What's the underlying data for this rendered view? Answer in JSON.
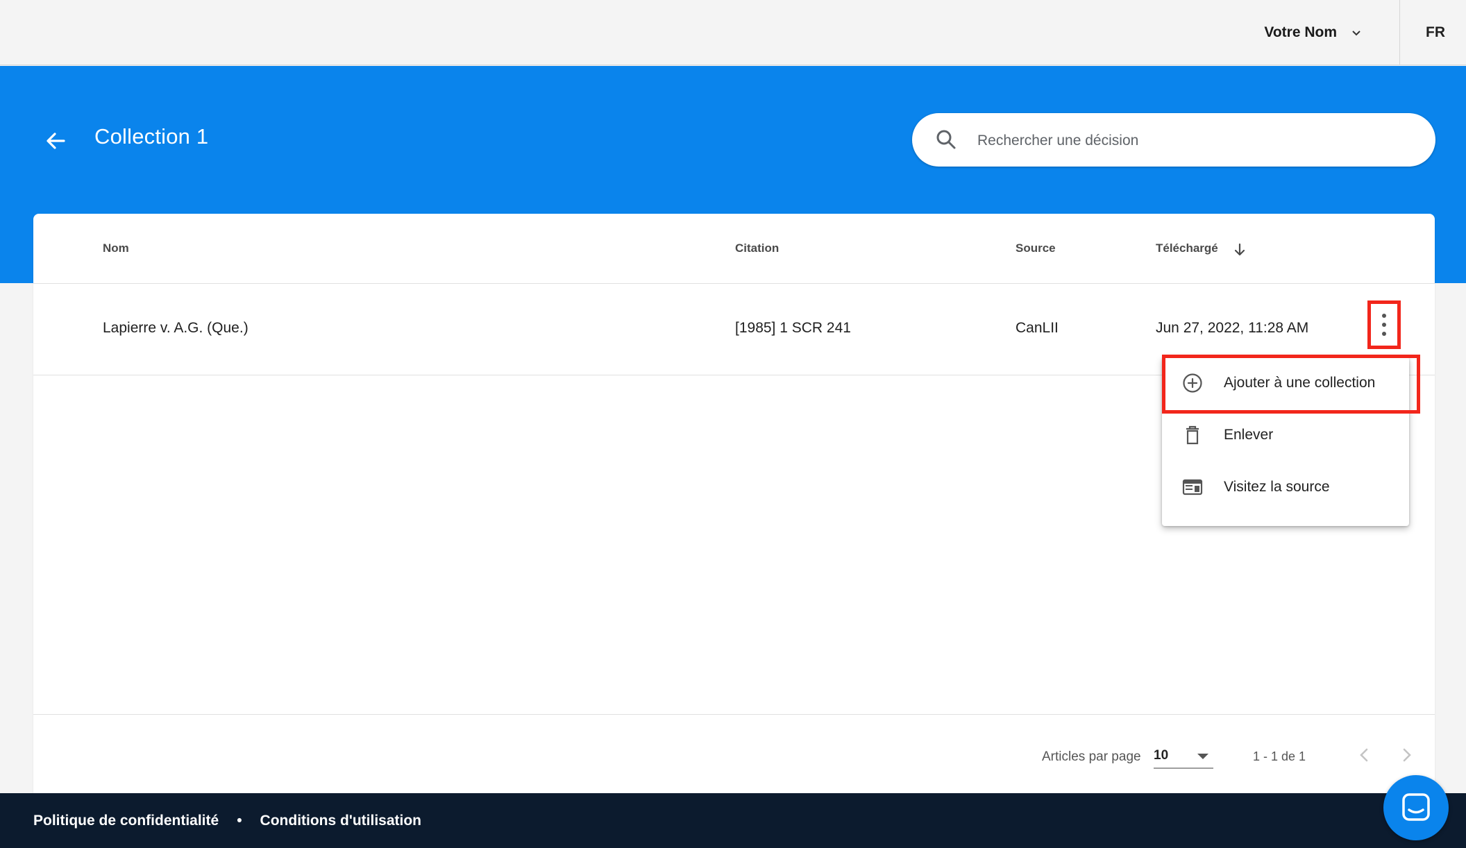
{
  "topbar": {
    "user_name": "Votre Nom",
    "language": "FR"
  },
  "header": {
    "title": "Collection 1",
    "search_placeholder": "Rechercher une décision"
  },
  "table": {
    "columns": [
      "Nom",
      "Citation",
      "Source",
      "Téléchargé"
    ],
    "rows": [
      {
        "name": "Lapierre v. A.G. (Que.)",
        "citation": "[1985] 1 SCR 241",
        "source": "CanLII",
        "downloaded": "Jun 27, 2022, 11:28 AM"
      }
    ]
  },
  "row_menu": {
    "items": [
      {
        "label": "Ajouter à une collection",
        "icon": "add-circle-icon"
      },
      {
        "label": "Enlever",
        "icon": "trash-icon"
      },
      {
        "label": "Visitez la source",
        "icon": "web-source-icon"
      }
    ]
  },
  "pagination": {
    "per_page_label": "Articles par page",
    "per_page_value": "10",
    "range": "1 - 1 de 1"
  },
  "footer": {
    "privacy": "Politique de confidentialité",
    "separator": "•",
    "terms": "Conditions d'utilisation"
  },
  "colors": {
    "brand_blue": "#0a84ec",
    "footer_navy": "#0c1b2e",
    "highlight_red": "#f2261b"
  }
}
